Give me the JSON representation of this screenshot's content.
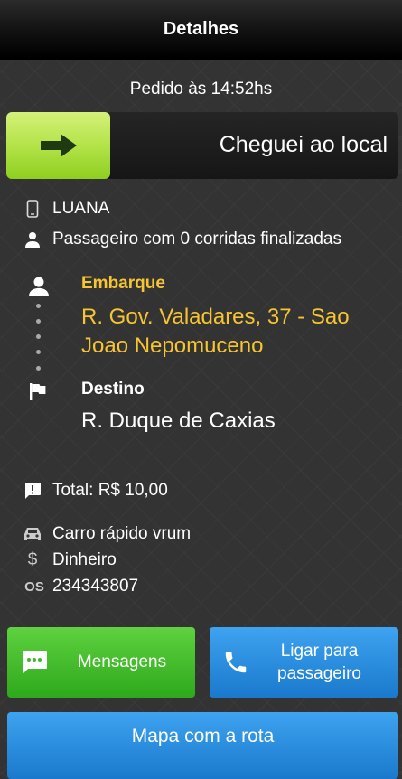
{
  "header": {
    "title": "Detalhes"
  },
  "order": {
    "time_text": "Pedido às 14:52hs"
  },
  "arrived": {
    "label": "Cheguei ao local"
  },
  "passenger": {
    "name": "LUANA",
    "rides_text": "Passageiro com 0 corridas finalizadas"
  },
  "route": {
    "pickup_label": "Embarque",
    "pickup_address": "R. Gov. Valadares, 37 - Sao Joao Nepomuceno",
    "destination_label": "Destino",
    "destination_address": "R. Duque de Caxias"
  },
  "details": {
    "total": "Total: R$ 10,00",
    "car_category": "Carro rápido vrum",
    "payment": "Dinheiro",
    "os_label": "OS",
    "os_number": "234343807"
  },
  "buttons": {
    "messages": "Mensagens",
    "call": "Ligar para passageiro",
    "map": "Mapa com a rota"
  },
  "colors": {
    "accent_yellow": "#f7c531",
    "green_button": "#3fba28",
    "blue_button": "#2a8ddf"
  },
  "icons": {
    "arrived_handle": "arrow-right-icon",
    "phone": "smartphone-icon",
    "person": "person-icon",
    "flag": "flag-icon",
    "total": "alert-bubble-icon",
    "car": "car-icon",
    "money": "dollar-icon",
    "messages": "chat-dots-icon",
    "call": "phone-icon"
  }
}
